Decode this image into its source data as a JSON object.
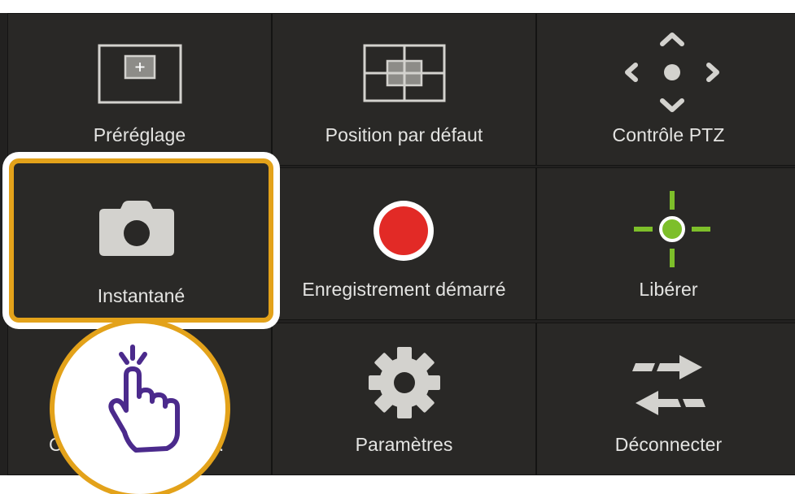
{
  "menu": {
    "items": [
      {
        "id": "preset",
        "label": "Préréglage",
        "icon": "preset-icon"
      },
      {
        "id": "default-position",
        "label": "Position par défaut",
        "icon": "grid-position-icon"
      },
      {
        "id": "ptz",
        "label": "Contrôle PTZ",
        "icon": "ptz-arrows-icon"
      },
      {
        "id": "snapshot",
        "label": "Instantané",
        "icon": "camera-icon"
      },
      {
        "id": "record",
        "label": "Enregistrement démarré",
        "icon": "record-icon"
      },
      {
        "id": "release",
        "label": "Libérer",
        "icon": "crosshair-icon"
      },
      {
        "id": "connect",
        "label_left": "Co",
        "label_right": "n.",
        "icon": "tap-hand-icon"
      },
      {
        "id": "settings",
        "label": "Paramètres",
        "icon": "gear-icon"
      },
      {
        "id": "disconnect",
        "label": "Déconnecter",
        "icon": "swap-arrows-icon"
      }
    ]
  },
  "colors": {
    "panel": "#222120",
    "cell": "#292826",
    "text": "#e4e4e2",
    "icon": "#d3d2ce",
    "highlight_ring": "#e3a21a",
    "record": "#e22a26",
    "release": "#7dbf2a",
    "hand": "#4b2a8c"
  }
}
